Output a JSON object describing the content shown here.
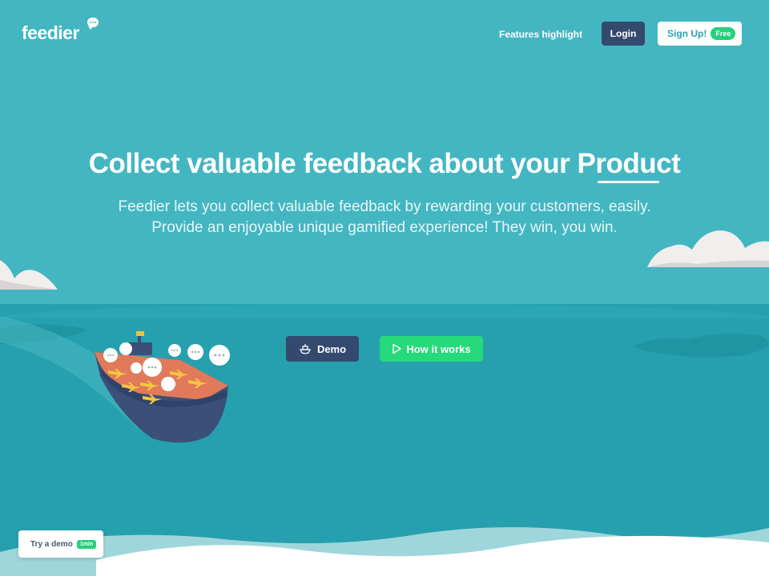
{
  "brand": {
    "name": "feedier"
  },
  "nav": {
    "features_label": "Features highlight",
    "login_label": "Login",
    "signup_label": "Sign Up!",
    "signup_badge": "Free"
  },
  "hero": {
    "title_prefix": "Collect valuable feedback about your ",
    "title_highlight": "Product",
    "subtitle_line1": "Feedier lets you collect valuable feedback by rewarding your customers, easily.",
    "subtitle_line2": "Provide an enjoyable unique gamified experience! They win, you win."
  },
  "cta": {
    "demo_label": "Demo",
    "how_label": "How it works"
  },
  "floating": {
    "try_label": "Try a demo",
    "try_badge": "1min"
  },
  "colors": {
    "sky": "#43b6c2",
    "sea": "#26a0ae",
    "navy": "#34496e",
    "green": "#26d97b"
  },
  "icons": {
    "demo": "ship-icon",
    "how": "play-icon"
  }
}
